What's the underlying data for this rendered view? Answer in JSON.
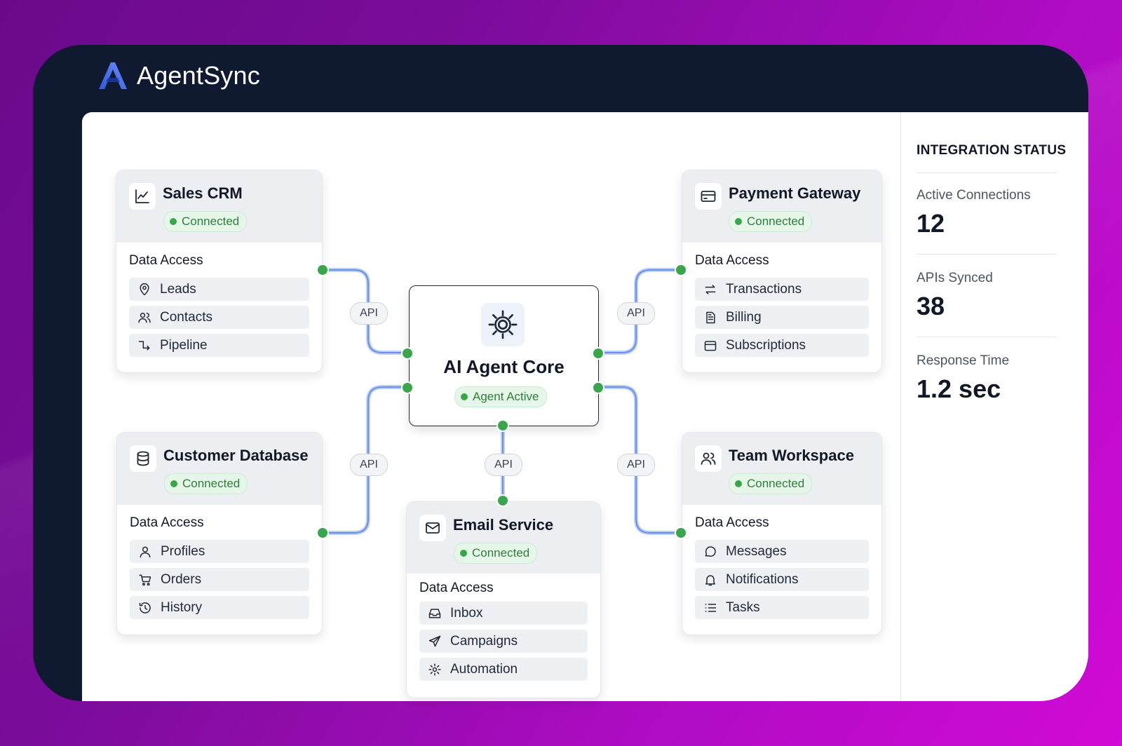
{
  "brand": {
    "name": "AgentSync",
    "accent": "#3b5bdb",
    "dark": "#0f1a30"
  },
  "status_panel": {
    "title": "INTEGRATION STATUS",
    "metrics": [
      {
        "label": "Active Connections",
        "value": "12"
      },
      {
        "label": "APIs Synced",
        "value": "38"
      },
      {
        "label": "Response Time",
        "value": "1.2 sec"
      }
    ]
  },
  "core": {
    "title": "AI Agent Core",
    "status": "Agent Active",
    "icon": "gear-icon"
  },
  "api_label": "API",
  "cards": {
    "sales_crm": {
      "title": "Sales CRM",
      "status": "Connected",
      "icon": "chart-line-icon",
      "section": "Data Access",
      "items": [
        {
          "label": "Leads",
          "icon": "map-pin-icon"
        },
        {
          "label": "Contacts",
          "icon": "users-icon"
        },
        {
          "label": "Pipeline",
          "icon": "pipeline-icon"
        }
      ]
    },
    "payment_gateway": {
      "title": "Payment Gateway",
      "status": "Connected",
      "icon": "credit-card-icon",
      "section": "Data Access",
      "items": [
        {
          "label": "Transactions",
          "icon": "arrows-swap-icon"
        },
        {
          "label": "Billing",
          "icon": "document-icon"
        },
        {
          "label": "Subscriptions",
          "icon": "calendar-icon"
        }
      ]
    },
    "customer_database": {
      "title": "Customer Database",
      "status": "Connected",
      "icon": "database-icon",
      "section": "Data Access",
      "items": [
        {
          "label": "Profiles",
          "icon": "user-icon"
        },
        {
          "label": "Orders",
          "icon": "cart-icon"
        },
        {
          "label": "History",
          "icon": "history-icon"
        }
      ]
    },
    "email_service": {
      "title": "Email Service",
      "status": "Connected",
      "icon": "mail-icon",
      "section": "Data Access",
      "items": [
        {
          "label": "Inbox",
          "icon": "inbox-icon"
        },
        {
          "label": "Campaigns",
          "icon": "send-icon"
        },
        {
          "label": "Automation",
          "icon": "cog-icon"
        }
      ]
    },
    "team_workspace": {
      "title": "Team Workspace",
      "status": "Connected",
      "icon": "team-icon",
      "section": "Data Access",
      "items": [
        {
          "label": "Messages",
          "icon": "chat-icon"
        },
        {
          "label": "Notifications",
          "icon": "bell-icon"
        },
        {
          "label": "Tasks",
          "icon": "list-icon"
        }
      ]
    }
  },
  "colors": {
    "connected_green": "#3aa64c",
    "link_blue": "#a9c0f2"
  }
}
